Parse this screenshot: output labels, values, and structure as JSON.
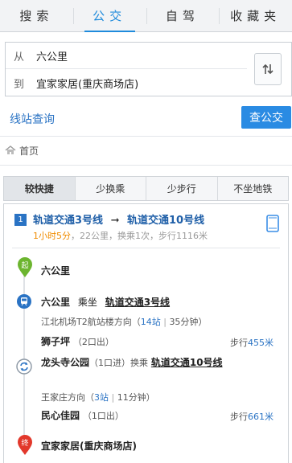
{
  "tabs": [
    {
      "label": "搜索",
      "active": false
    },
    {
      "label": "公交",
      "active": true
    },
    {
      "label": "自驾",
      "active": false
    },
    {
      "label": "收藏夹",
      "active": false
    }
  ],
  "route": {
    "from_label": "从",
    "from_value": "六公里",
    "to_label": "到",
    "to_value": "宜家家居(重庆商场店)",
    "swap_icon": "swap-arrows-icon"
  },
  "line_query": "线站查询",
  "search_button": "查公交",
  "breadcrumb": {
    "home_icon": "home-icon",
    "label": "首页"
  },
  "sort_tabs": [
    {
      "label": "较快捷",
      "active": true
    },
    {
      "label": "少换乘",
      "active": false
    },
    {
      "label": "少步行",
      "active": false
    },
    {
      "label": "不坐地铁",
      "active": false
    }
  ],
  "plan": {
    "number": "1",
    "line1": "轨道交通3号线",
    "arrow": "➞",
    "line2": "轨道交通10号线",
    "time": "1小时5分",
    "meta": "，22公里，换乘1次，步行1116米",
    "steps": {
      "start": {
        "badge": "起",
        "name": "六公里"
      },
      "board": {
        "station": "六公里",
        "verb": "乘坐",
        "line": "轨道交通3号线",
        "direction": "江北机场T2航站楼方向",
        "paren_open": "（",
        "stops": "14站",
        "sep": "|",
        "minutes": "35分钟",
        "paren_close": "）",
        "alight": "狮子坪",
        "exit": "（2口出）",
        "walk_label": "步行",
        "walk": "455米"
      },
      "transfer": {
        "station": "龙头寺公园",
        "entry": "（1口进）换乘",
        "line": "轨道交通10号线",
        "direction": "王家庄方向",
        "paren_open": "（",
        "stops": "3站",
        "sep": "|",
        "minutes": "11分钟",
        "paren_close": "）",
        "alight": "民心佳园",
        "exit": "（1口出）",
        "walk_label": "步行",
        "walk": "661米"
      },
      "end": {
        "badge": "终",
        "name": "宜家家居(重庆商场店)"
      }
    }
  },
  "colors": {
    "accent": "#2a8be3",
    "link": "#2a73c4",
    "time": "#f08c00",
    "start": "#6cb52f",
    "end": "#e2382b"
  }
}
